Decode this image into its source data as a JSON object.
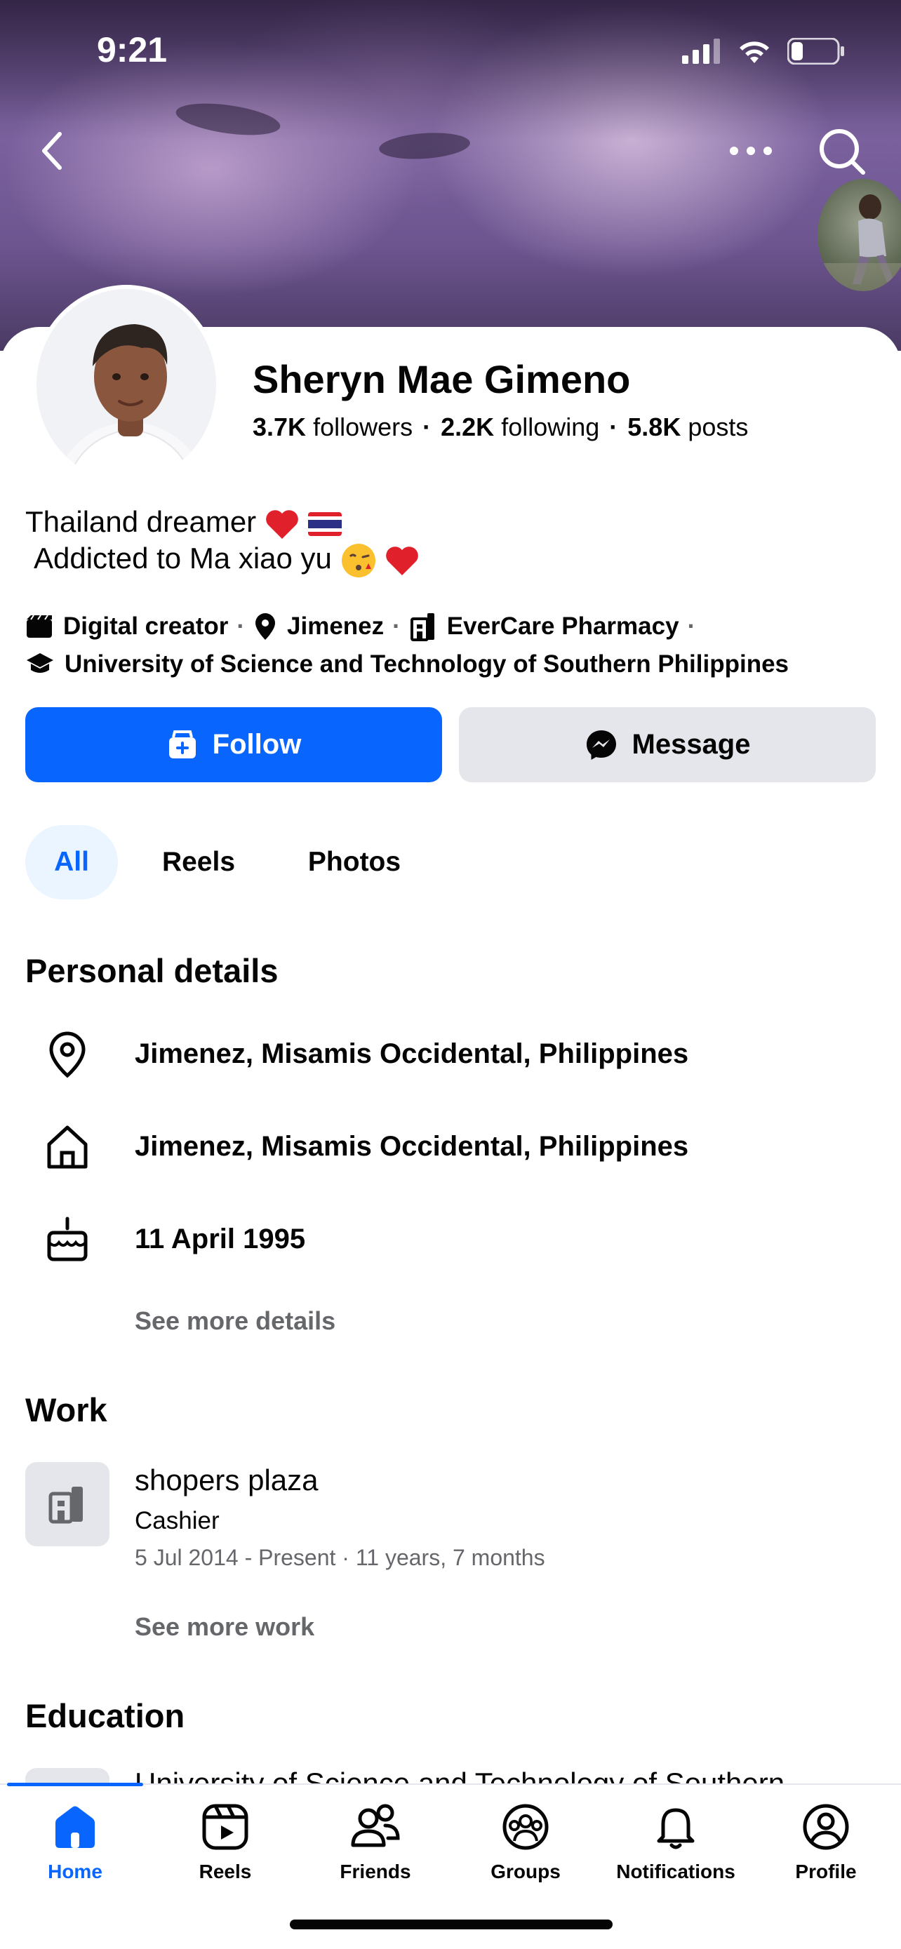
{
  "status_bar": {
    "time": "9:21"
  },
  "profile": {
    "name": "Sheryn Mae Gimeno",
    "followers_count": "3.7K",
    "followers_label": "followers",
    "following_count": "2.2K",
    "following_label": "following",
    "posts_count": "5.8K",
    "posts_label": "posts",
    "bio_line1": "Thailand dreamer ",
    "bio_line2": "Addicted to Ma xiao yu"
  },
  "intro": {
    "category": "Digital creator",
    "location": "Jimenez",
    "workplace": "EverCare Pharmacy",
    "school": "University of Science and Technology of Southern Philippines"
  },
  "actions": {
    "follow_label": "Follow",
    "message_label": "Message"
  },
  "filters": {
    "all": "All",
    "reels": "Reels",
    "photos": "Photos"
  },
  "personal_details": {
    "title": "Personal details",
    "current_city": "Jimenez, Misamis Occidental, Philippines",
    "hometown": "Jimenez, Misamis Occidental, Philippines",
    "birthday": "11 April 1995",
    "see_more": "See more details"
  },
  "work": {
    "title": "Work",
    "employer": "shopers plaza",
    "position": "Cashier",
    "dates": "5 Jul 2014 - Present · 11 years, 7 months",
    "see_more": "See more work"
  },
  "education": {
    "title": "Education",
    "first_item": "University of Science and Technology of Southern"
  },
  "tabbar": {
    "home": "Home",
    "reels": "Reels",
    "friends": "Friends",
    "groups": "Groups",
    "notifications": "Notifications",
    "profile": "Profile"
  },
  "colors": {
    "accent": "#0866ff",
    "secondary_text": "#65676b",
    "button_gray": "#e4e6eb"
  },
  "icons": [
    "back-arrow-icon",
    "more-icon",
    "search-icon",
    "follow-icon",
    "messenger-icon",
    "location-pin-icon",
    "home-icon",
    "birthday-cake-icon",
    "building-icon",
    "graduation-cap-icon",
    "clapperboard-icon",
    "reels-icon",
    "friends-icon",
    "groups-icon",
    "bell-icon",
    "profile-icon"
  ]
}
